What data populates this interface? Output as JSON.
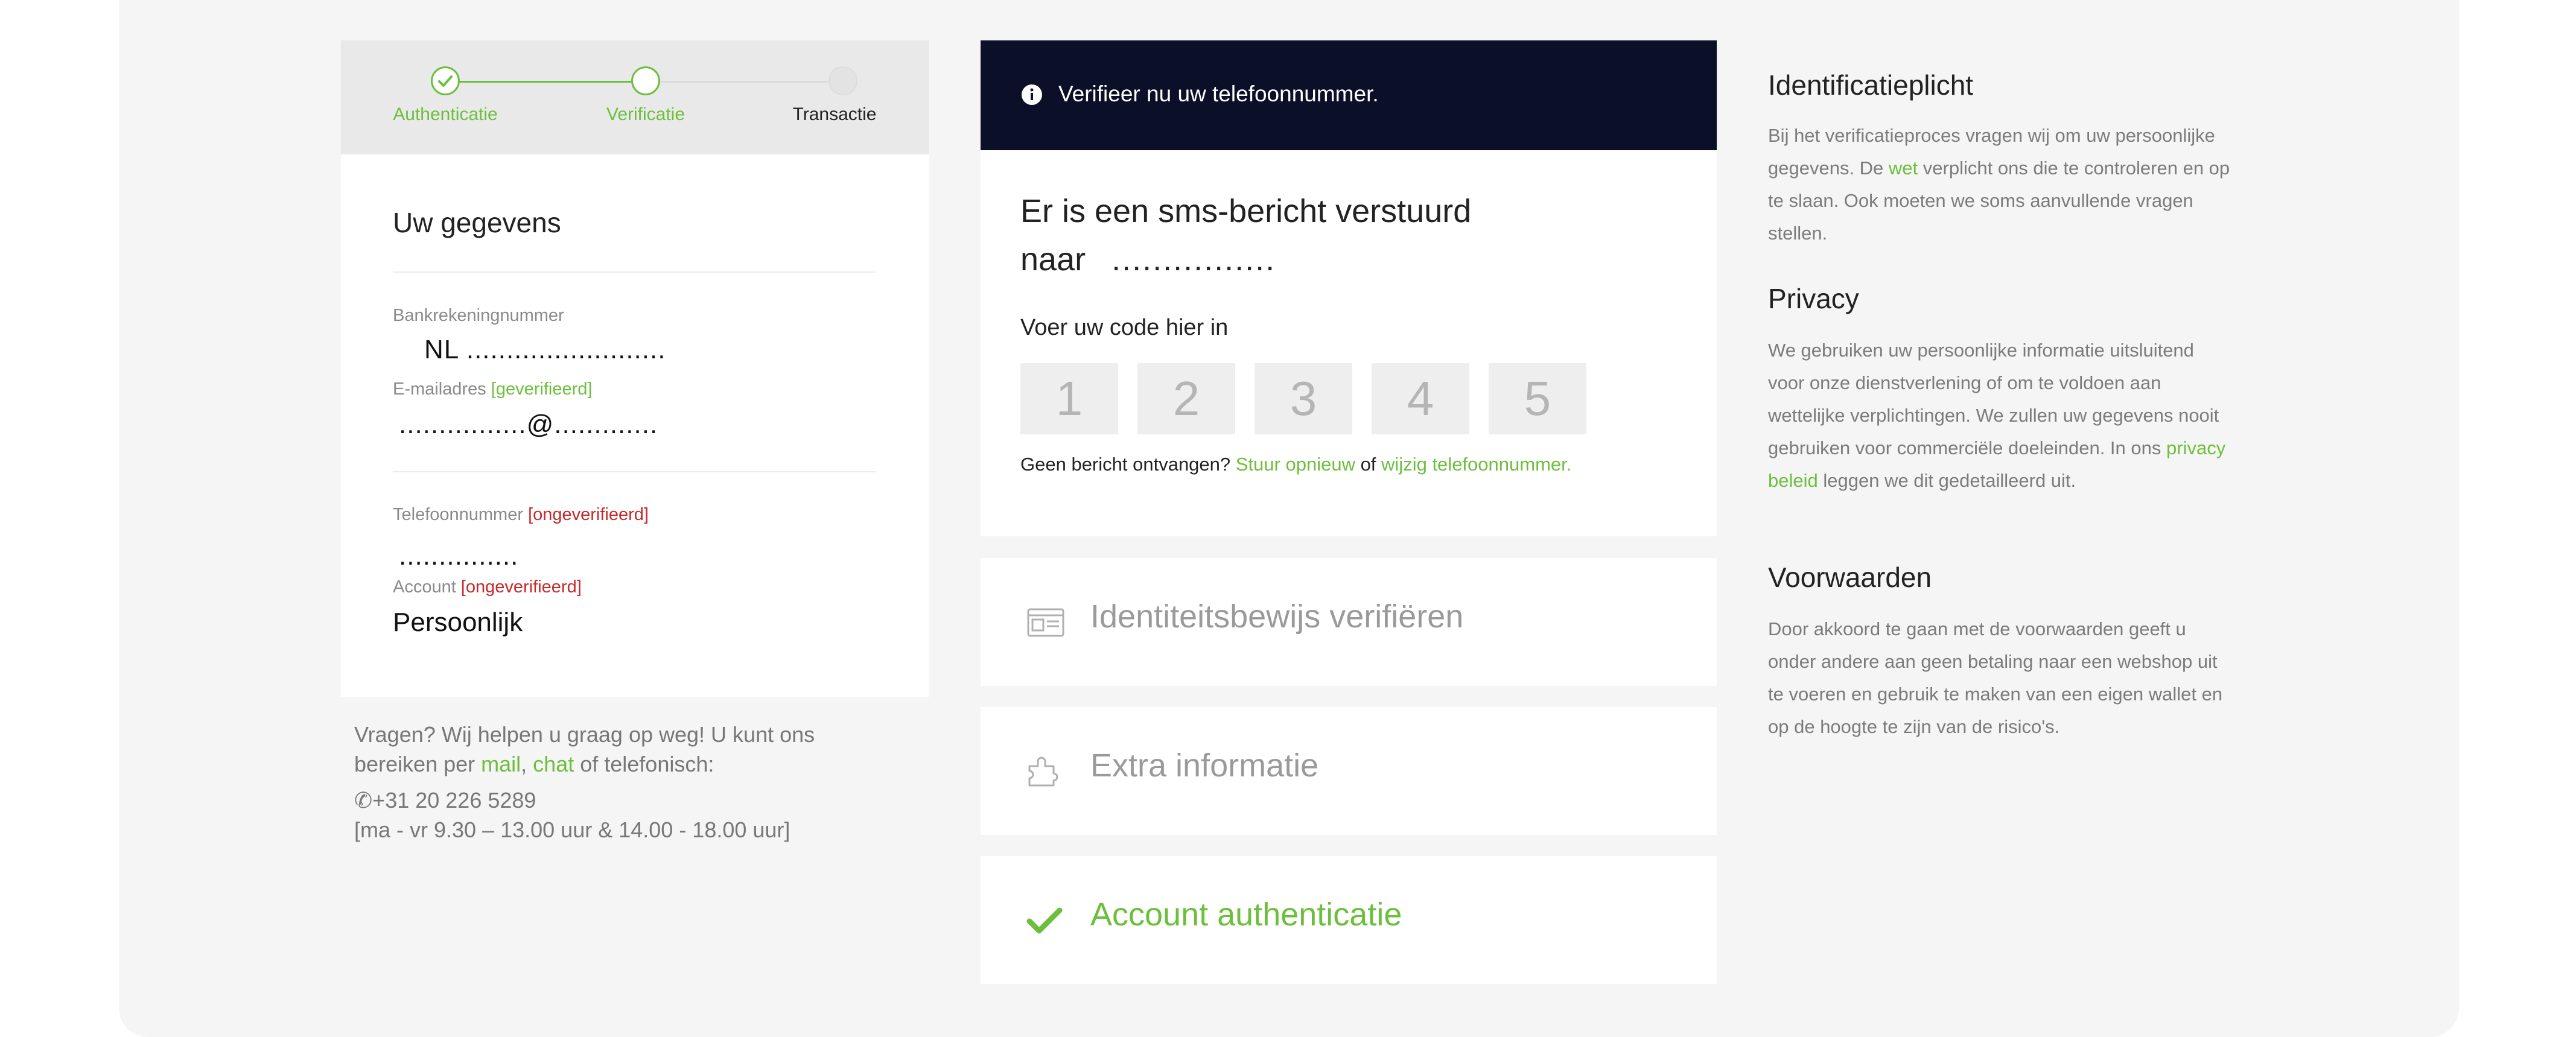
{
  "stepper": {
    "steps": [
      {
        "label": "Authenticatie",
        "state": "done"
      },
      {
        "label": "Verificatie",
        "state": "active"
      },
      {
        "label": "Transactie",
        "state": "pending"
      }
    ]
  },
  "details": {
    "title": "Uw gegevens",
    "bank": {
      "label": "Bankrekeningnummer",
      "value": "NL ........................."
    },
    "email": {
      "label": "E-mailadres",
      "tag": "[geverifieerd]",
      "value": "................@............."
    },
    "phone": {
      "label": "Telefoonnummer",
      "tag": "[ongeverifieerd]",
      "value": "..............."
    },
    "account": {
      "label": "Account",
      "tag": "[ongeverifieerd]",
      "value": "Persoonlijk"
    }
  },
  "help": {
    "line1": "Vragen? Wij helpen u graag op weg! U kunt ons",
    "line2_prefix": "bereiken per ",
    "mail_link": "mail",
    "separator": ", ",
    "chat_link": "chat",
    "line2_suffix": " of telefonisch:",
    "phone": "+31 20 226 5289",
    "hours": "[ma - vr 9.30 – 13.00 uur & 14.00 - 18.00 uur]"
  },
  "verify": {
    "banner": "Verifieer nu uw telefoonnummer.",
    "sms_line1": "Er is een sms-bericht verstuurd",
    "sms_line2": "naar",
    "sms_number": "................",
    "code_label": "Voer uw code hier in",
    "code_placeholders": [
      "1",
      "2",
      "3",
      "4",
      "5"
    ],
    "resend_prefix": "Geen bericht ontvangen? ",
    "resend_link": "Stuur opnieuw",
    "resend_mid": " of ",
    "change_link": "wijzig telefoonnummer."
  },
  "sections": [
    {
      "title": "Identiteitsbewijs verifiëren",
      "icon": "id-card-icon"
    },
    {
      "title": "Extra informatie",
      "icon": "puzzle-icon"
    },
    {
      "title": "Account authenticatie",
      "icon": "checkmark-icon"
    }
  ],
  "info": {
    "identification_title": "Identificatieplicht",
    "identification_text_1": "Bij het verificatieproces vragen wij om uw persoonlijke gegevens. De ",
    "identification_link": "wet",
    "identification_text_2": " verplicht ons die te controleren en op te slaan. Ook moeten we soms aanvullende vragen stellen.",
    "privacy_title": "Privacy",
    "privacy_text_1": "We gebruiken uw persoonlijke informatie uitsluitend voor onze dienstverlening of om te voldoen aan wettelijke verplichtingen. We zullen uw gegevens nooit gebruiken voor commerciële doeleinden. In ons ",
    "privacy_link": "privacy beleid",
    "privacy_text_2": " leggen we dit gedetailleerd uit.",
    "terms_title": "Voorwaarden",
    "terms_text": "Door akkoord te gaan met de voorwaarden geeft u onder andere aan geen betaling naar een webshop uit te voeren en gebruik te maken van een eigen wallet en op de hoogte te zijn van de risico's."
  },
  "colors": {
    "accent_green": "#6cbf3c",
    "error_red": "#c8282a",
    "banner_navy": "#0c0f28"
  }
}
